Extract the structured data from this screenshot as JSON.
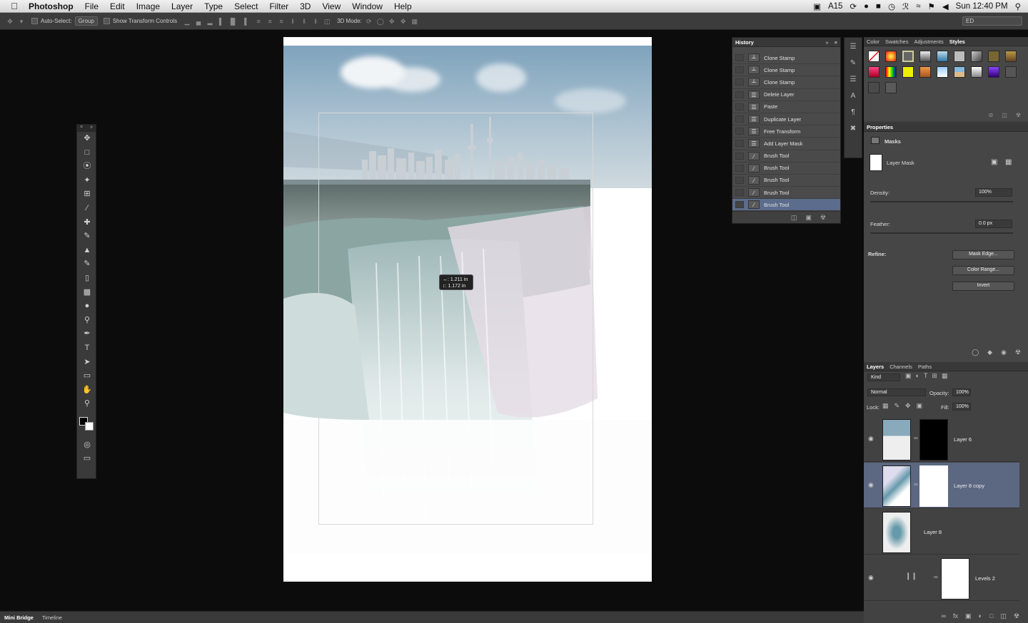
{
  "menubar": {
    "app_name": "Photoshop",
    "items": [
      "File",
      "Edit",
      "Image",
      "Layer",
      "Type",
      "Select",
      "Filter",
      "3D",
      "View",
      "Window",
      "Help"
    ],
    "status_badge": "15",
    "clock": "Sun 12:40 PM"
  },
  "options_bar": {
    "auto_select_label": "Auto-Select:",
    "auto_select_value": "Group",
    "show_transform_label": "Show Transform Controls",
    "mode_label": "3D Mode:",
    "workspace_value": "ED"
  },
  "canvas": {
    "tooltip_w": "↔: 1.211 in",
    "tooltip_h": "↕: 1.172 in"
  },
  "history": {
    "title": "History",
    "items": [
      {
        "label": "Clone Stamp",
        "icon": "stamp-icon"
      },
      {
        "label": "Clone Stamp",
        "icon": "stamp-icon"
      },
      {
        "label": "Clone Stamp",
        "icon": "stamp-icon"
      },
      {
        "label": "Delete Layer",
        "icon": "document-icon"
      },
      {
        "label": "Paste",
        "icon": "document-icon"
      },
      {
        "label": "Duplicate Layer",
        "icon": "document-icon"
      },
      {
        "label": "Free Transform",
        "icon": "document-icon"
      },
      {
        "label": "Add Layer Mask",
        "icon": "document-icon"
      },
      {
        "label": "Brush Tool",
        "icon": "brush-icon"
      },
      {
        "label": "Brush Tool",
        "icon": "brush-icon"
      },
      {
        "label": "Brush Tool",
        "icon": "brush-icon"
      },
      {
        "label": "Brush Tool",
        "icon": "brush-icon"
      },
      {
        "label": "Brush Tool",
        "icon": "brush-icon",
        "selected": true
      }
    ]
  },
  "styles_panel": {
    "tabs": [
      "Color",
      "Swatches",
      "Adjustments",
      "Styles"
    ],
    "active_tab": "Styles"
  },
  "properties": {
    "title": "Properties",
    "section": "Masks",
    "mask_label": "Layer Mask",
    "density_label": "Density:",
    "density_value": "100%",
    "feather_label": "Feather:",
    "feather_value": "0.0 px",
    "refine_label": "Refine:",
    "mask_edge_button": "Mask Edge...",
    "color_range_button": "Color Range...",
    "invert_button": "Invert"
  },
  "layers": {
    "tabs": [
      "Layers",
      "Channels",
      "Paths"
    ],
    "filter_kind": "Kind",
    "blend_mode": "Normal",
    "opacity_label": "Opacity:",
    "opacity_value": "100%",
    "lock_label": "Lock:",
    "fill_label": "Fill:",
    "fill_value": "100%",
    "rows": [
      {
        "name": "Layer 6"
      },
      {
        "name": "Layer 8 copy",
        "selected": true
      },
      {
        "name": "Layer 8"
      },
      {
        "name": "Levels 2"
      }
    ]
  },
  "bottom_bar": {
    "tabs": [
      "Mini Bridge",
      "Timeline"
    ]
  }
}
